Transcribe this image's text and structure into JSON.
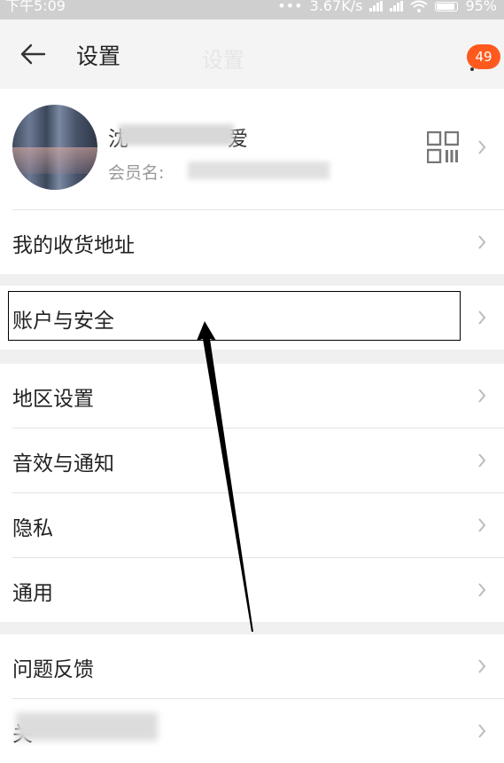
{
  "status_bar": {
    "time": "下午5:09",
    "network_speed": "3.67K/s",
    "battery": "95%"
  },
  "header": {
    "title": "设置",
    "ghost_title": "设置",
    "badge_count": "49"
  },
  "profile": {
    "name_partial_start": "沈",
    "name_partial_end": "爱",
    "member_label": "会员名:"
  },
  "menu": {
    "address": "我的收货地址",
    "account_security": "账户与安全",
    "region": "地区设置",
    "sound_notify": "音效与通知",
    "privacy": "隐私",
    "general": "通用",
    "feedback": "问题反馈",
    "about_partial": "关"
  },
  "colors": {
    "accent": "#ff5a1e",
    "background": "#f0f0f0"
  }
}
